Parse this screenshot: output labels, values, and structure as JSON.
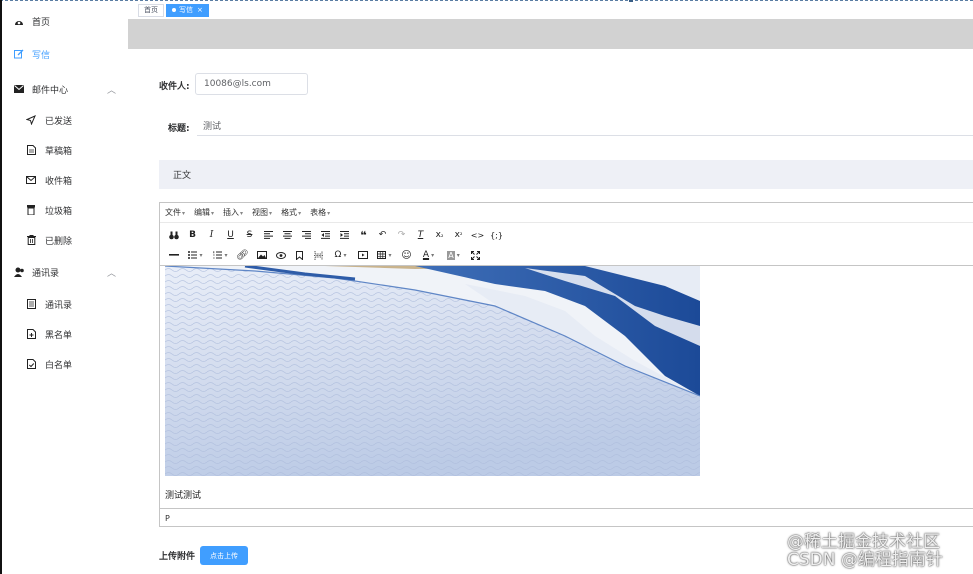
{
  "sidebar": {
    "items": [
      {
        "label": "首页",
        "icon": "dashboard-icon"
      },
      {
        "label": "写信",
        "icon": "edit-icon",
        "active": true
      },
      {
        "label": "邮件中心",
        "icon": "mail-icon",
        "expanded": true
      },
      {
        "label": "已发送",
        "icon": "send-icon"
      },
      {
        "label": "草稿箱",
        "icon": "draft-icon"
      },
      {
        "label": "收件箱",
        "icon": "inbox-icon"
      },
      {
        "label": "垃圾箱",
        "icon": "trash-icon"
      },
      {
        "label": "已删除",
        "icon": "delete-icon"
      },
      {
        "label": "通讯录",
        "icon": "contacts-icon",
        "expanded": true
      },
      {
        "label": "通讯录",
        "icon": "address-book-icon"
      },
      {
        "label": "黑名单",
        "icon": "blacklist-icon"
      },
      {
        "label": "白名单",
        "icon": "whitelist-icon"
      }
    ]
  },
  "tabs": [
    {
      "label": "首页"
    },
    {
      "label": "写信",
      "active": true,
      "close": "×"
    }
  ],
  "form": {
    "recipient_label": "收件人:",
    "recipient_value": "10086@ls.com",
    "subject_label": "标题:",
    "subject_value": "测试",
    "body_label": "正文"
  },
  "editor": {
    "menus": [
      "文件",
      "编辑",
      "插入",
      "视图",
      "格式",
      "表格"
    ],
    "toolbar_row1": [
      "find-replace-icon",
      "bold-icon",
      "italic-icon",
      "underline-icon",
      "strikethrough-icon",
      "align-left-icon",
      "align-center-icon",
      "align-right-icon",
      "outdent-icon",
      "indent-icon",
      "blockquote-icon",
      "undo-icon",
      "redo-icon",
      "clear-format-icon",
      "subscript-icon",
      "superscript-icon",
      "code-icon",
      "code-sample-icon"
    ],
    "toolbar_row2": [
      "horizontal-rule-icon",
      "bullet-list-icon",
      "numbered-list-icon",
      "link-icon",
      "image-icon",
      "preview-icon",
      "bookmark-icon",
      "page-break-icon",
      "special-char-icon",
      "media-icon",
      "table-icon",
      "emoji-icon",
      "text-color-icon",
      "background-color-icon",
      "fullscreen-icon"
    ],
    "content_text": "测试测试",
    "status_path": "P"
  },
  "upload": {
    "label": "上传附件",
    "button": "点击上传"
  },
  "watermark": {
    "line1": "@稀土掘金技术社区",
    "line2": "CSDN @编程指南针"
  },
  "colors": {
    "accent": "#409eff",
    "graybar": "#d2d2d2",
    "body_header_bg": "#eef0f6"
  }
}
